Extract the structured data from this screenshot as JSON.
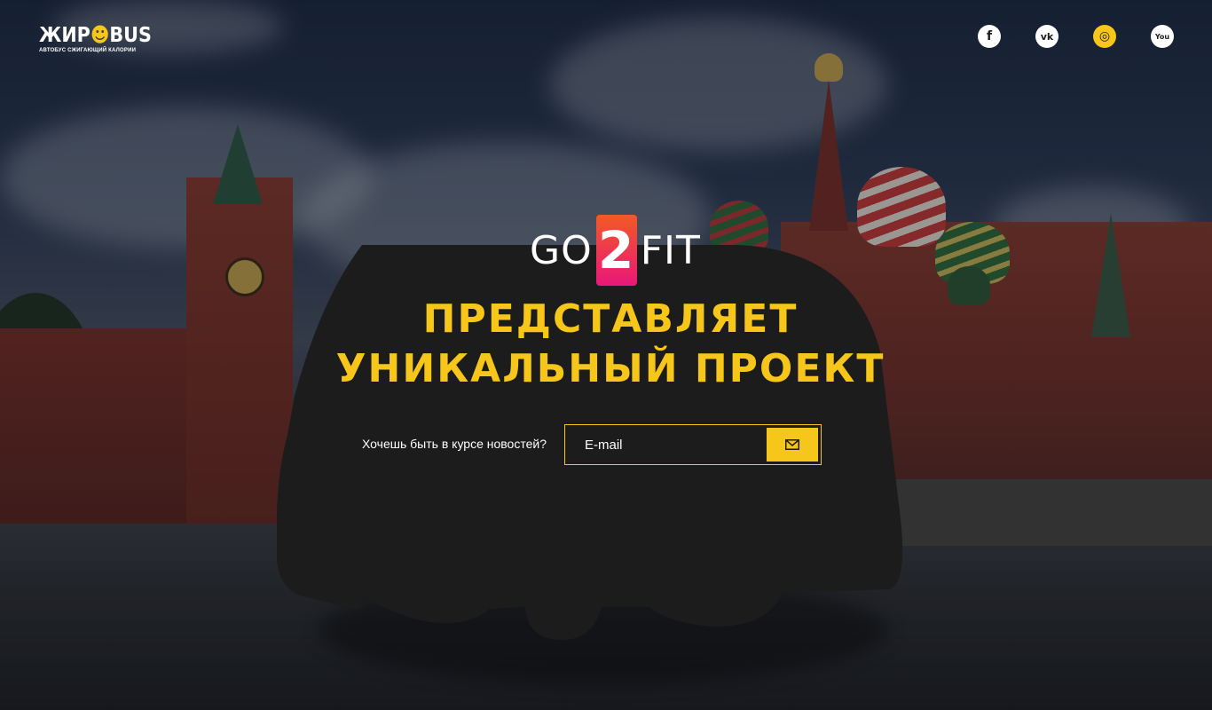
{
  "logo": {
    "name_part1": "ЖИР",
    "name_accent": "☻",
    "name_part2": "BUS",
    "tagline": "АВТОБУС СЖИГАЮЩИЙ КАЛОРИИ"
  },
  "social": [
    {
      "name": "facebook",
      "glyph": "f"
    },
    {
      "name": "vk",
      "glyph": "vk"
    },
    {
      "name": "instagram",
      "glyph": "◎"
    },
    {
      "name": "youtube",
      "glyph": "You"
    }
  ],
  "brand": {
    "left": "GO",
    "number": "2",
    "right": "FIT"
  },
  "headline": {
    "line1": "ПРЕДСТАВЛЯЕТ",
    "line2": "УНИКАЛЬНЫЙ ПРОЕКТ"
  },
  "subscribe": {
    "label": "Хочешь быть в курсе новостей?",
    "placeholder": "E-mail",
    "icon": "envelope-icon"
  },
  "colors": {
    "accent": "#f6c61a",
    "bus": "#1c1c1c",
    "brand_gradient_top": "#f15a24",
    "brand_gradient_bottom": "#e9177a"
  }
}
